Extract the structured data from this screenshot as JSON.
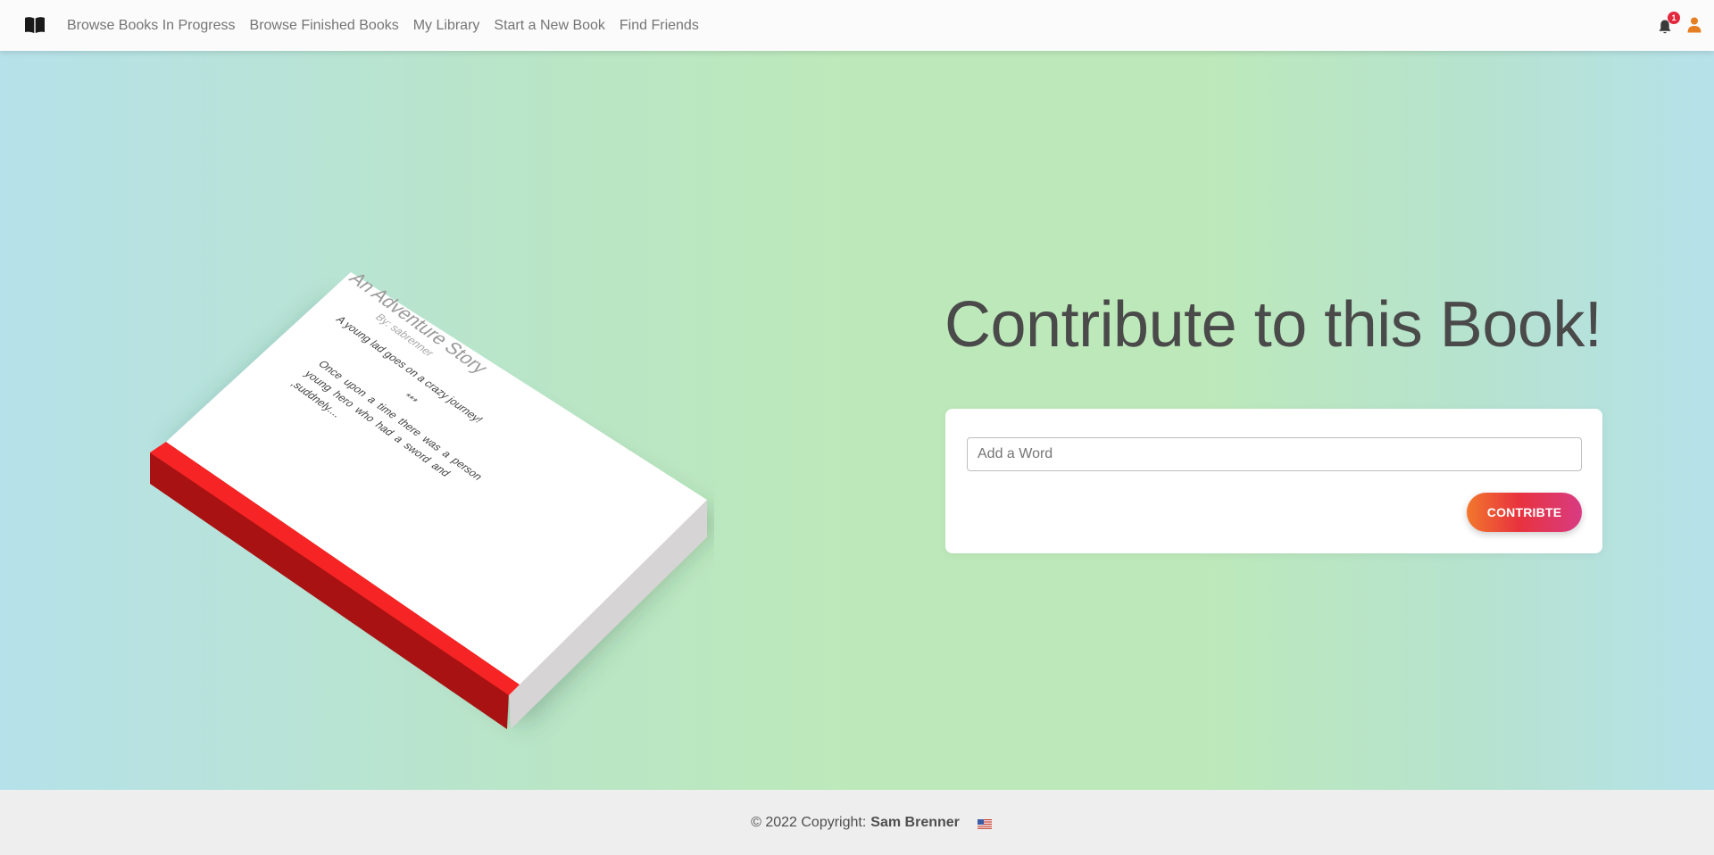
{
  "nav": {
    "brand_icon": "book-open-icon",
    "links": [
      {
        "label": "Browse Books In Progress"
      },
      {
        "label": "Browse Finished Books"
      },
      {
        "label": "My Library"
      },
      {
        "label": "Start a New Book"
      },
      {
        "label": "Find Friends"
      }
    ],
    "notifications": {
      "icon": "bell-icon",
      "count": "1"
    },
    "user_icon": "user-icon",
    "accent_color": "#e67e22"
  },
  "book": {
    "title": "An Adventure Story",
    "author": "By: sabrenner",
    "summary": "A young lad goes on a crazy journey!",
    "separator": "***",
    "body": "Once upon a time there was a person young hero who had a sword and ,suddnely....",
    "spine_color": "#f62424"
  },
  "contribute": {
    "heading": "Contribute to this Book!",
    "input_placeholder": "Add a Word",
    "button_label": "CONTRIBTE"
  },
  "footer": {
    "copyright": "© 2022 Copyright:",
    "author": "Sam Brenner",
    "flag_icon": "us-flag-icon"
  }
}
